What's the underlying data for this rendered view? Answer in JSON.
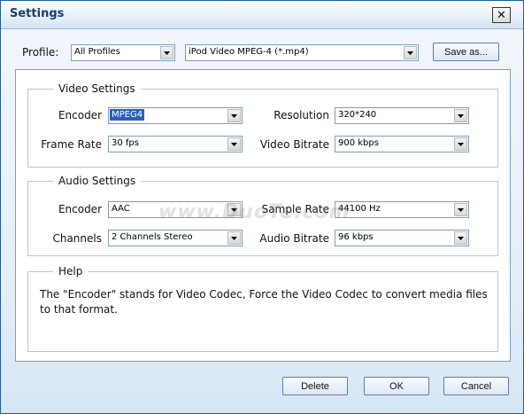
{
  "window": {
    "title": "Settings",
    "close_glyph": "✕"
  },
  "profile": {
    "label": "Profile:",
    "category": "All Profiles",
    "format": "iPod Video MPEG-4 (*.mp4)",
    "save_as_label": "Save as..."
  },
  "video": {
    "legend": "Video Settings",
    "encoder_label": "Encoder",
    "encoder_value": "MPEG4",
    "resolution_label": "Resolution",
    "resolution_value": "320*240",
    "frame_rate_label": "Frame Rate",
    "frame_rate_value": "30 fps",
    "bitrate_label": "Video Bitrate",
    "bitrate_value": "900 kbps"
  },
  "audio": {
    "legend": "Audio Settings",
    "encoder_label": "Encoder",
    "encoder_value": "AAC",
    "sample_rate_label": "Sample Rate",
    "sample_rate_value": "44100 Hz",
    "channels_label": "Channels",
    "channels_value": "2 Channels Stereo",
    "bitrate_label": "Audio Bitrate",
    "bitrate_value": "96 kbps"
  },
  "help": {
    "legend": "Help",
    "text": "The \"Encoder\" stands for Video Codec, Force the Video Codec to convert media files to that format."
  },
  "buttons": {
    "delete_label": "Delete",
    "ok_label": "OK",
    "cancel_label": "Cancel"
  },
  "watermark": {
    "text": "www.DuoTe.com"
  },
  "icons": {
    "dropdown": "chevron-down-icon",
    "close": "close-icon"
  },
  "colors": {
    "title_text": "#1c3c66",
    "selection": "#2a5fbf",
    "border": "#7f9db9"
  }
}
